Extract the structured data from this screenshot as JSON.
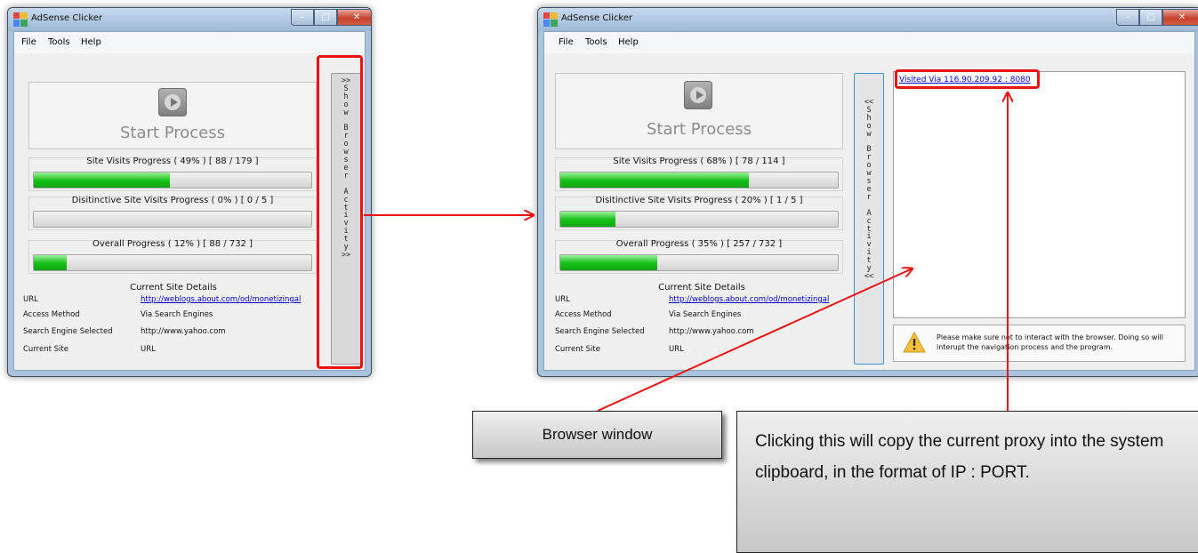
{
  "window": {
    "title": "AdSense Clicker"
  },
  "menu": [
    "File",
    "Tools",
    "Help"
  ],
  "left_window": {
    "start_label": "Start Process",
    "site_visits": {
      "label": "Site Visits Progress ( 49% ) [ 88 / 179 ]",
      "progress": 0.49
    },
    "distinctive_visits": {
      "label": "Disitinctive Site Visits Progress ( 0% ) [ 0 / 5 ]",
      "progress": 0.0
    },
    "overall": {
      "label": "Overall Progress ( 12% ) [ 88 / 732 ]",
      "progress": 0.12
    },
    "toggle_text": ">>\nS\nh\no\nw\n \nB\nr\no\nw\ns\ne\nr\n \nA\nc\nt\ni\nv\ni\nt\ny\n>>"
  },
  "right_window": {
    "start_label": "Start Process",
    "site_visits": {
      "label": "Site Visits Progress ( 68% ) [ 78 / 114 ]",
      "progress": 0.68
    },
    "distinctive_visits": {
      "label": "Disitinctive Site Visits Progress ( 20% ) [ 1 / 5 ]",
      "progress": 0.2
    },
    "overall": {
      "label": "Overall Progress ( 35% ) [ 257 / 732 ]",
      "progress": 0.35
    },
    "toggle_text": "<<\nS\nh\no\nw\n \nB\nr\no\nw\ns\ne\nr\n \nA\nc\nt\ni\nv\ni\nt\ny\n<<",
    "visited_link": "Visited Via 116.90.209.92 : 8080",
    "warning": "Please make sure not to interact with the browser. Doing so will interupt the navigation process and the program."
  },
  "details": {
    "title": "Current Site Details",
    "rows": [
      {
        "label": "URL",
        "value": "http://weblogs.about.com/od/monetizingal"
      },
      {
        "label": "Access Method",
        "value": "Via Search Engines"
      },
      {
        "label": "Search Engine Selected",
        "value": "http://www.yahoo.com"
      },
      {
        "label": "Current Site",
        "value": "URL"
      }
    ]
  },
  "callouts": {
    "browser_window": "Browser window",
    "clipboard_note": "Clicking this will copy the current proxy into the system clipboard, in the format of IP : PORT."
  },
  "colors": {
    "annotation": "#ee1111",
    "progress": "#19c219",
    "link": "#0000cc"
  },
  "icons": [
    "app-icon",
    "play-icon",
    "minimize-icon",
    "maximize-icon",
    "close-icon",
    "warning-icon"
  ]
}
